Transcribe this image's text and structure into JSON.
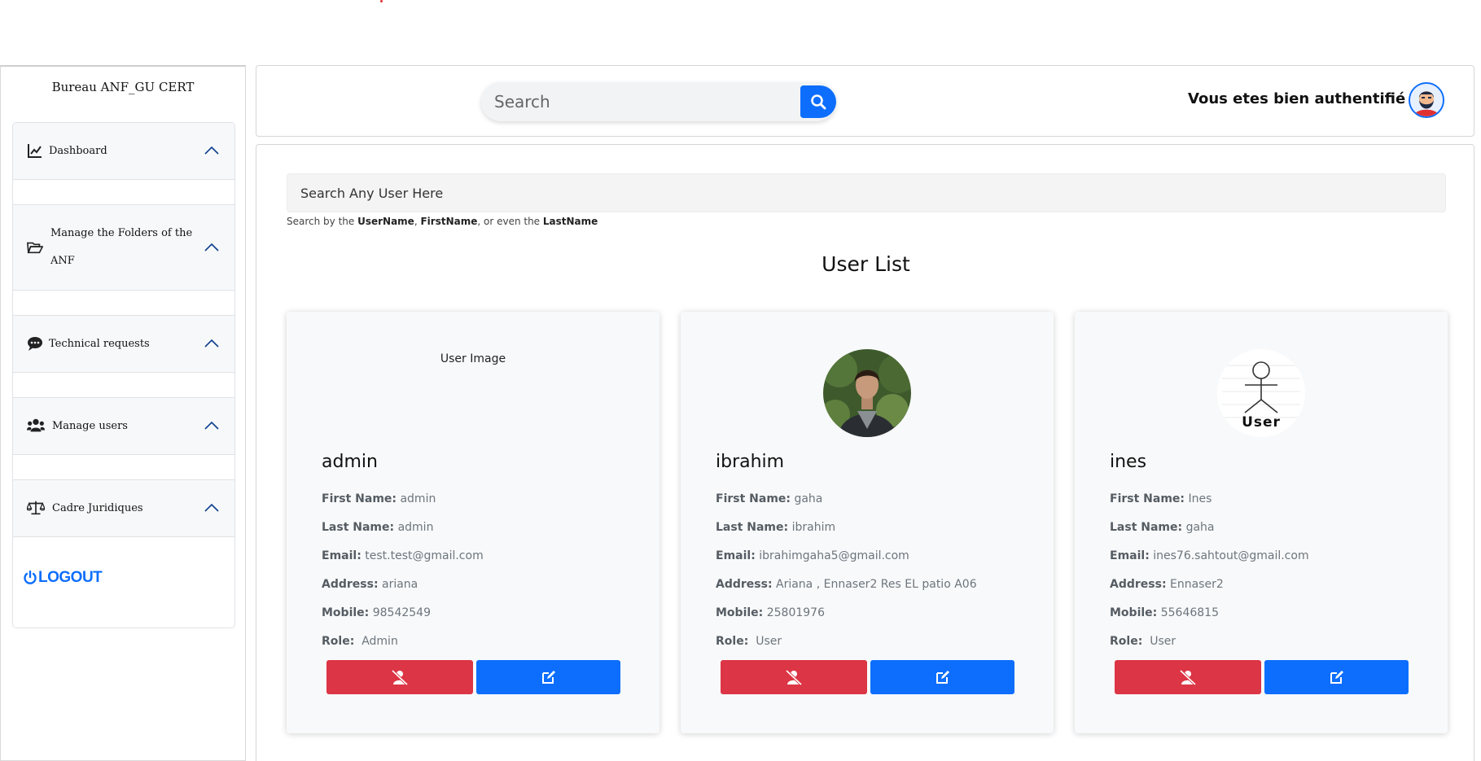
{
  "sidebar": {
    "brand": "Bureau ANF_GU CERT",
    "items": [
      {
        "label": "Dashboard",
        "icon": "chart-line-icon"
      },
      {
        "label": "Manage the Folders of the",
        "label2": "ANF",
        "icon": "folder-open-icon"
      },
      {
        "label": "Technical requests",
        "icon": "comments-icon"
      },
      {
        "label": "Manage users",
        "icon": "users-icon"
      },
      {
        "label": "Cadre Juridiques",
        "icon": "balance-scale-icon"
      }
    ],
    "logout_label": "LOGOUT"
  },
  "header": {
    "search_placeholder": "Search",
    "auth_text": "Vous etes bien authentifié"
  },
  "main": {
    "search_placeholder": "Search Any User Here",
    "helper": {
      "prefix": "Search by the ",
      "k1": "UserName",
      "sep1": ", ",
      "k2": "FirstName",
      "sep2": ", or even the ",
      "k3": "LastName"
    },
    "list_title": "User List",
    "labels": {
      "first_name": "First Name:",
      "last_name": "Last Name:",
      "email": "Email:",
      "address": "Address:",
      "mobile": "Mobile:",
      "role": "Role:"
    },
    "users": [
      {
        "username": "admin",
        "image_alt": "User Image",
        "first_name": "admin",
        "last_name": "admin",
        "email": "test.test@gmail.com",
        "address": "ariana",
        "mobile": "98542549",
        "role": "Admin"
      },
      {
        "username": "ibrahim",
        "first_name": "gaha",
        "last_name": "ibrahim",
        "email": "ibrahimgaha5@gmail.com",
        "address": "Ariana , Ennaser2 Res EL patio A06",
        "mobile": "25801976",
        "role": "User"
      },
      {
        "username": "ines",
        "image_caption": "User",
        "first_name": "Ines",
        "last_name": "gaha",
        "email": "ines76.sahtout@gmail.com",
        "address": "Ennaser2",
        "mobile": "55646815",
        "role": "User"
      }
    ]
  },
  "colors": {
    "primary": "#0d6efd",
    "danger": "#dc3545",
    "card_bg": "#f8f9fa"
  }
}
